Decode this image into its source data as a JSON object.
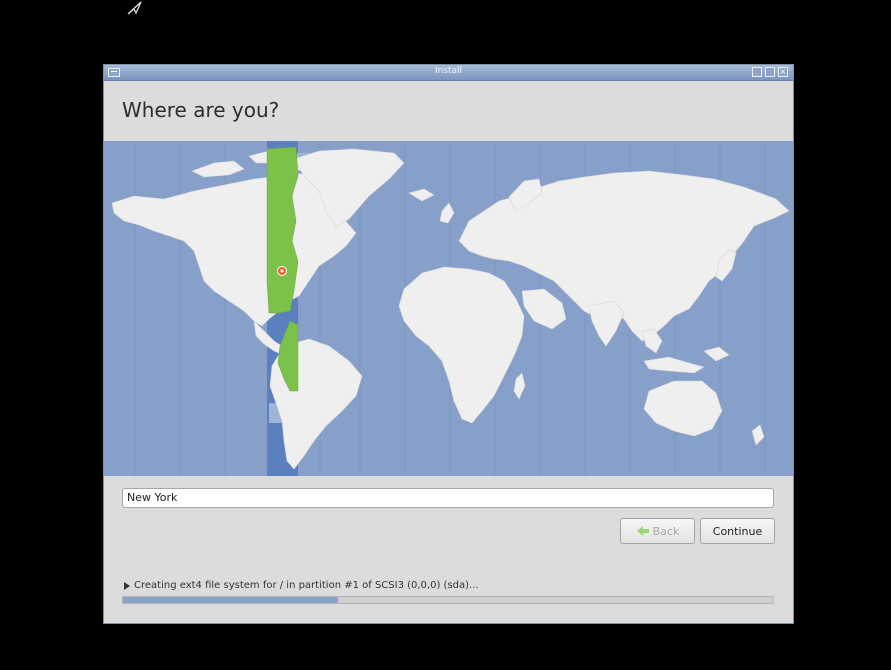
{
  "window": {
    "title": "Install"
  },
  "page": {
    "heading": "Where are you?"
  },
  "location": {
    "value": "New York"
  },
  "buttons": {
    "back": "Back",
    "continue": "Continue"
  },
  "status": {
    "text": "Creating ext4 file system for / in partition #1 of SCSI3 (0,0,0) (sda)..."
  },
  "progress": {
    "fraction": 0.33
  },
  "colors": {
    "ocean": "#87a0c9",
    "land": "#efefef",
    "selected_timezone": "#7cc24a",
    "timezone_band": "#5a80c0",
    "titlebar": "#7a96c0"
  },
  "icons": {
    "cursor": "mouse-pointer-icon",
    "back": "back-arrow-icon",
    "status_expander": "triangle-right-icon",
    "location_pin": "map-pin-icon"
  }
}
